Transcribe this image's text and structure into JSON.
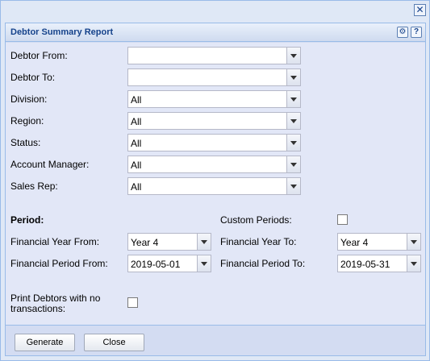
{
  "window": {
    "close_symbol": "✕"
  },
  "panel": {
    "title": "Debtor Summary Report",
    "header_buttons": {
      "gear": "⚙",
      "help": "?"
    }
  },
  "form": {
    "debtor_from": {
      "label": "Debtor From:",
      "value": ""
    },
    "debtor_to": {
      "label": "Debtor To:",
      "value": ""
    },
    "division": {
      "label": "Division:",
      "value": "All"
    },
    "region": {
      "label": "Region:",
      "value": "All"
    },
    "status": {
      "label": "Status:",
      "value": "All"
    },
    "account_manager": {
      "label": "Account Manager:",
      "value": "All"
    },
    "sales_rep": {
      "label": "Sales Rep:",
      "value": "All"
    },
    "period": {
      "label": "Period:"
    },
    "custom_periods": {
      "label": "Custom Periods:",
      "checked": false
    },
    "financial_year_from": {
      "label": "Financial Year From:",
      "value": "Year 4"
    },
    "financial_year_to": {
      "label": "Financial Year To:",
      "value": "Year 4"
    },
    "financial_period_from": {
      "label": "Financial Period From:",
      "value": "2019-05-01"
    },
    "financial_period_to": {
      "label": "Financial Period To:",
      "value": "2019-05-31"
    },
    "print_debtors": {
      "label_line1": "Print Debtors with no",
      "label_line2": "transactions:",
      "checked": false
    }
  },
  "footer": {
    "generate_label": "Generate",
    "close_label": "Close"
  }
}
